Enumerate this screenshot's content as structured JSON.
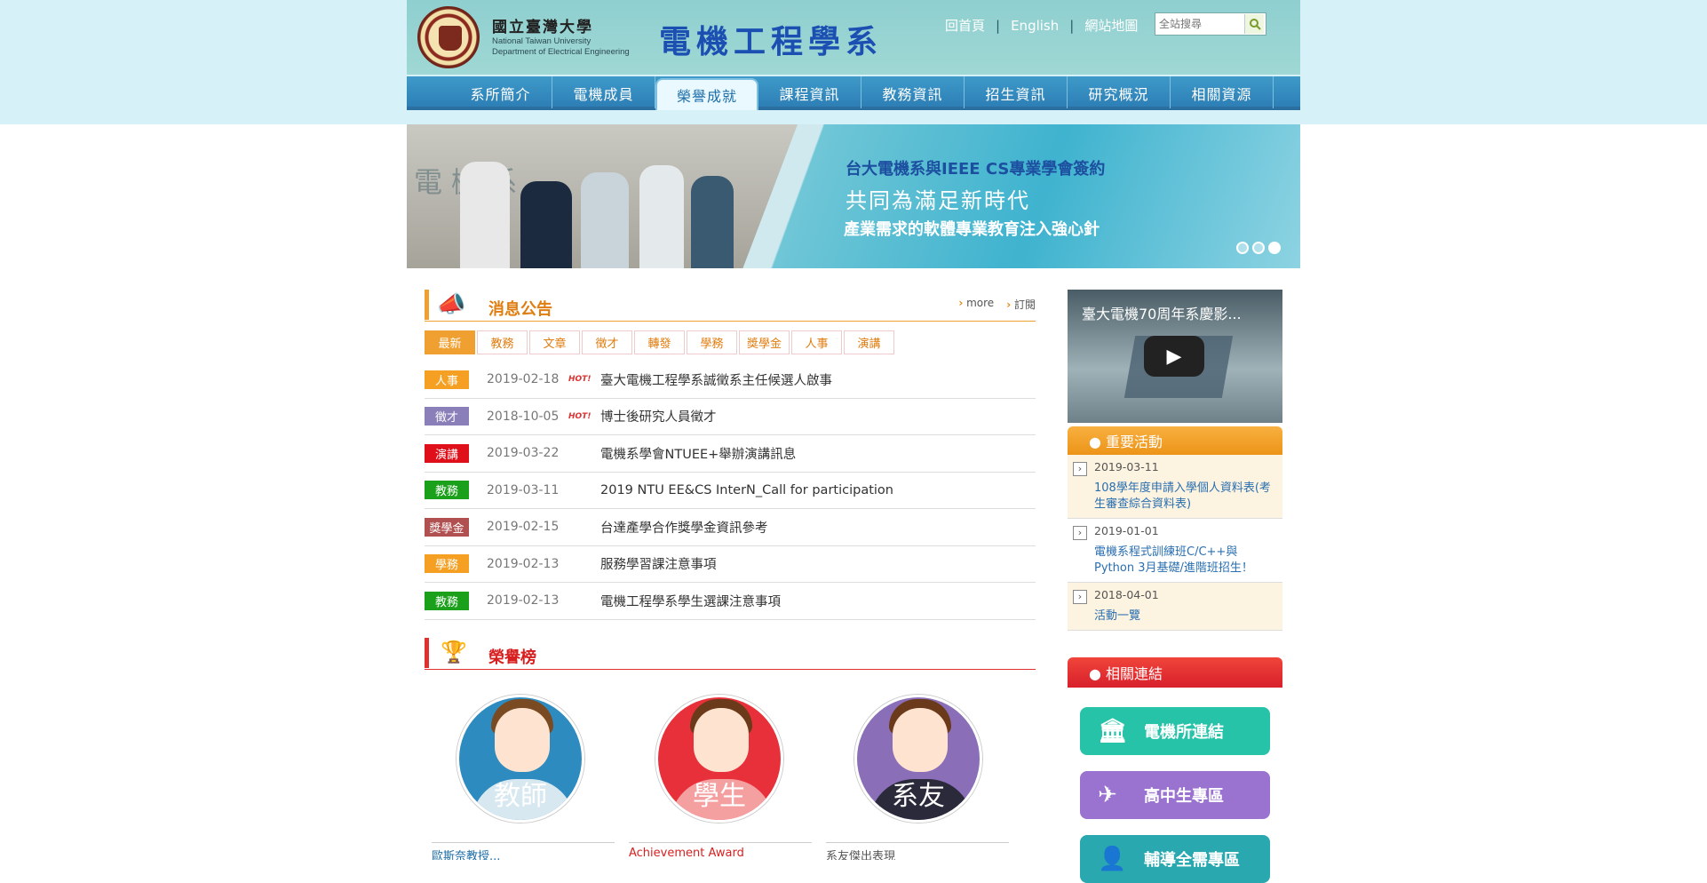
{
  "header": {
    "univ_zh": "國立臺灣大學",
    "univ_en1": "National Taiwan University",
    "univ_en2": "Department of Electrical Engineering",
    "dept_title": "電機工程學系",
    "links": [
      "回首頁",
      "English",
      "網站地圖"
    ],
    "search_placeholder": "全站搜尋"
  },
  "nav": [
    "系所簡介",
    "電機成員",
    "榮譽成就",
    "課程資訊",
    "教務資訊",
    "招生資訊",
    "研究概況",
    "相關資源"
  ],
  "banner": {
    "line1": "台大電機系與IEEE CS專業學會簽約",
    "line2": "共同為滿足新時代",
    "line3": "產業需求的軟體專業教育注入強心針",
    "wall_text": "電 機 系"
  },
  "news": {
    "title": "消息公告",
    "more": "more",
    "subscribe": "訂閱",
    "tabs": [
      "最新",
      "教務",
      "文章",
      "徵才",
      "轉發",
      "學務",
      "獎學金",
      "人事",
      "演講"
    ],
    "hot_label": "HOT!",
    "items": [
      {
        "cat": "人事",
        "color": "#f5a023",
        "date": "2019-02-18",
        "hot": true,
        "title": "臺大電機工程學系誠徵系主任候選人啟事"
      },
      {
        "cat": "徵才",
        "color": "#8a7fb8",
        "date": "2018-10-05",
        "hot": true,
        "title": "博士後研究人員徵才"
      },
      {
        "cat": "演講",
        "color": "#e0101a",
        "date": "2019-03-22",
        "hot": false,
        "title": "電機系學會NTUEE+舉辦演講訊息"
      },
      {
        "cat": "教務",
        "color": "#1aa01a",
        "date": "2019-03-11",
        "hot": false,
        "title": "2019 NTU EE&CS InterN_Call for participation"
      },
      {
        "cat": "獎學金",
        "color": "#b05050",
        "date": "2019-02-15",
        "hot": false,
        "title": "台達產學合作獎學金資訊參考"
      },
      {
        "cat": "學務",
        "color": "#f5a023",
        "date": "2019-02-13",
        "hot": false,
        "title": "服務學習課注意事項"
      },
      {
        "cat": "教務",
        "color": "#1aa01a",
        "date": "2019-02-13",
        "hot": false,
        "title": "電機工程學系學生選課注意事項"
      }
    ]
  },
  "honor": {
    "title": "榮譽榜",
    "cards": [
      {
        "label": "教師",
        "bg": "#2e8bbf",
        "caption": "歐斯奈教授..."
      },
      {
        "label": "學生",
        "bg": "#e8303a",
        "caption": "Achievement Award"
      },
      {
        "label": "系友",
        "bg": "#8a6fb8",
        "caption": "系友傑出表現"
      }
    ]
  },
  "sidebar": {
    "video_title": "臺大電機70周年系慶影...",
    "important_title": "● 重要活動",
    "events": [
      {
        "date": "2019-03-11",
        "desc": "108學年度申請入學個人資料表(考生審查綜合資料表)"
      },
      {
        "date": "2019-01-01",
        "desc": "電機系程式訓練班C/C++與Python 3月基礎/進階班招生！"
      },
      {
        "date": "2018-04-01",
        "desc": "活動一覽"
      }
    ],
    "related_title": "● 相關連結",
    "buttons": [
      {
        "label": "電機所連結",
        "bg": "#26c3a8",
        "icon": "building-icon"
      },
      {
        "label": "高中生專區",
        "bg": "#9a72cf",
        "icon": "paper-plane-icon"
      },
      {
        "label": "輔導全需專區",
        "bg": "#2aa8b0",
        "icon": "person-icon"
      }
    ]
  }
}
